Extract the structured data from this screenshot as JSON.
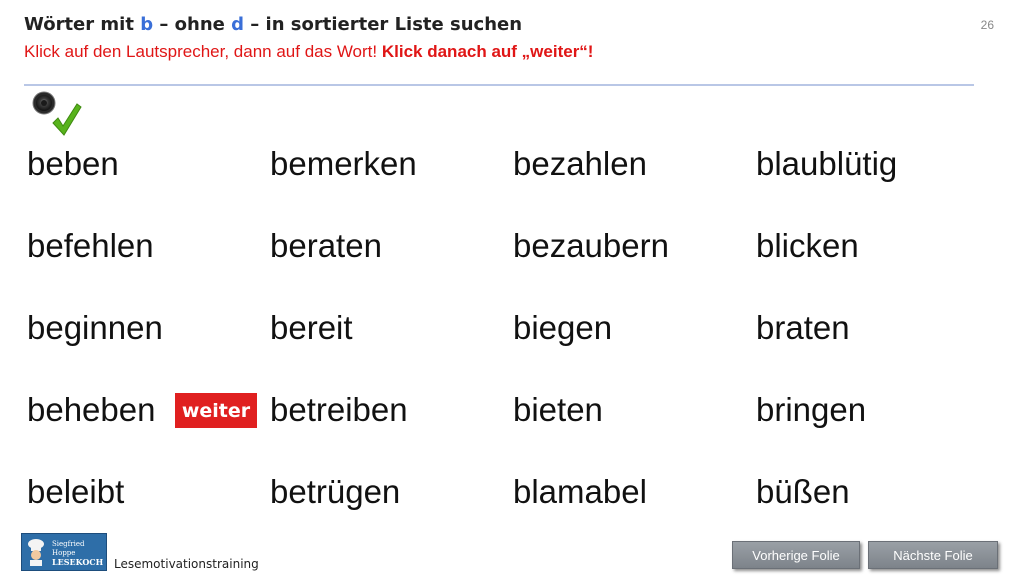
{
  "header": {
    "title_prefix": "Wörter mit ",
    "title_b": "b",
    "title_mid": " – ohne ",
    "title_d": "d",
    "title_suffix": " – in sortierter Liste suchen",
    "instruction": "Klick auf den Lautsprecher, dann auf das Wort! ",
    "instruction_bold": "Klick danach auf „weiter“!",
    "page_number": "26"
  },
  "icons": {
    "speaker": "speaker-icon",
    "check": "checkmark-icon"
  },
  "words": [
    "beben",
    "bemerken",
    "bezahlen",
    "blaublütig",
    "befehlen",
    "beraten",
    "bezaubern",
    "blicken",
    "beginnen",
    "bereit",
    "biegen",
    "braten",
    "beheben",
    "betreiben",
    "bieten",
    "bringen",
    "beleibt",
    "betrügen",
    "blamabel",
    "büßen"
  ],
  "weiter_label": "weiter",
  "footer": {
    "logo_line1": "Siegfried Hoppe",
    "logo_line2": "LESEKOCH",
    "label": "Lesemotivationstraining",
    "prev_label": "Vorherige  Folie",
    "next_label": "Nächste  Folie"
  },
  "colors": {
    "instruction": "#e01616",
    "highlight_letter": "#3a6fd8",
    "weiter_bg": "#e02020",
    "nav_bg": "#8a9096",
    "check": "#58b31c"
  }
}
